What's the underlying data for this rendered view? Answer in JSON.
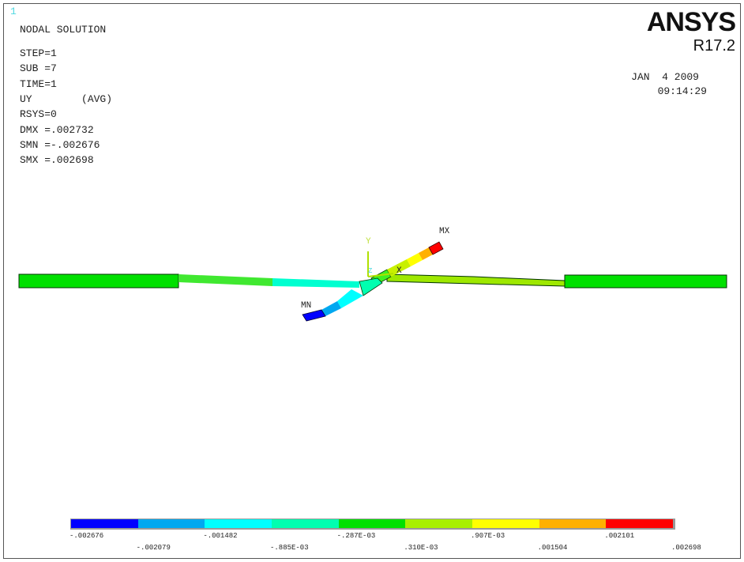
{
  "window_number": "1",
  "brand": {
    "logo": "ANSYS",
    "version": "R17.2"
  },
  "date": "JAN  4 2009",
  "time": "09:14:29",
  "info": {
    "title": "NODAL SOLUTION",
    "lines": [
      "STEP=1",
      "SUB =7",
      "TIME=1",
      "UY        (AVG)",
      "RSYS=0",
      "DMX =.002732",
      "SMN =-.002676",
      "SMX =.002698"
    ]
  },
  "markers": {
    "max": "MX",
    "min": "MN",
    "axis_y": "Y",
    "axis_x": "X",
    "axis_z": "Z"
  },
  "legend": {
    "colors": [
      "#0000ff",
      "#00a8f0",
      "#00ffff",
      "#00ffb0",
      "#00e000",
      "#a8f000",
      "#ffff00",
      "#ffb000",
      "#ff0000"
    ],
    "labels": [
      "-.002676",
      "-.002079",
      "-.001482",
      "-.885E-03",
      "-.287E-03",
      ".310E-03",
      ".907E-03",
      ".001504",
      ".002101",
      ".002698"
    ]
  }
}
